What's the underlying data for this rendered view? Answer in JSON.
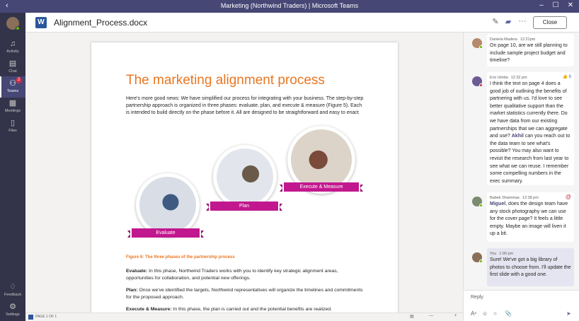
{
  "titlebar": {
    "back": "‹",
    "title": "Marketing (Northwind Traders)  |  Microsoft Teams",
    "minimize": "–",
    "maximize": "☐",
    "close": "✕"
  },
  "rail": {
    "items": [
      {
        "label": "Activity",
        "icon": "bell-icon",
        "glyph": "🔔"
      },
      {
        "label": "Chat",
        "icon": "chat-icon",
        "glyph": "▤"
      },
      {
        "label": "Teams",
        "icon": "teams-icon",
        "glyph": "⚇",
        "badge": "2"
      },
      {
        "label": "Meetings",
        "icon": "calendar-icon",
        "glyph": "▦"
      },
      {
        "label": "Files",
        "icon": "file-icon",
        "glyph": "▯"
      }
    ],
    "bottom": [
      {
        "label": "Feedback",
        "icon": "lightbulb-icon",
        "glyph": "♢"
      },
      {
        "label": "Settings",
        "icon": "gear-icon",
        "glyph": "⚙"
      }
    ]
  },
  "header": {
    "filename": "Alignment_Process.docx",
    "word_letter": "W",
    "close_label": "Close",
    "edit_glyph": "✎",
    "chat_glyph": "▰",
    "more_glyph": "···"
  },
  "document": {
    "heading": "The marketing alignment process",
    "intro": "Here's more good news: We have simplified our process for integrating with your business. The step-by-step partnership approach is organized in three phases: evaluate, plan, and execute & measure (Figure 5). Each is intended to build directly on the phase before it. All are designed to be straightforward and easy to enact",
    "phases": [
      "Evaluate",
      "Plan",
      "Execute & Measure"
    ],
    "caption": "Figure 6: The three phases of the partnership process",
    "paragraphs": [
      {
        "term": "Evaluate:",
        "text": " In this phase, Northwind Traders works with you to identify key strategic alignment areas, opportunities for collaboration, and potential new offerings."
      },
      {
        "term": "Plan:",
        "text": " Once we've identified the targets, Northwind representatives will organize the timelines and commitments for the proposed approach."
      },
      {
        "term": "Execute & Measure:",
        "text": " In this phase, the plan is carried out and the potential benefits are realized."
      }
    ]
  },
  "statusbar": {
    "page": "PAGE 1 OF 1",
    "minus": "—",
    "plus": "+"
  },
  "chat": {
    "messages": [
      {
        "author": "Daniela Madera",
        "time": "12:21pm",
        "text": "On page 10, are we still planning to include sample project budget and timeline?",
        "avatar_color": "#b5896b"
      },
      {
        "author": "Eric Ishida",
        "time": "12:32 pm",
        "likes": "6",
        "text_before": "I think the text on page 4 does a good job of outlining the benefits of partnering with us.  I'd love to see better qualitative support than the market statistics currently there. Do we have data from our existing partnerships that we can aggregate and use? ",
        "mention": "Akhil",
        "text_after": " can you reach out to the data team to see what's possible?  You may also want to revisit the research from last year to see what we can reuse. I remember some compelling numbers in the exec summary.",
        "avatar_color": "#6b5b95"
      },
      {
        "author": "Babek Shammas",
        "time": "12:38 pm",
        "mention": "Miguel",
        "text_after": ", does the design team have any stock photography we can use for the cover page?  It feels a little empty. Maybe an image will liven it up a bit.",
        "avatar_color": "#7a8b6f"
      },
      {
        "author": "You",
        "time": "1:00 pm",
        "text": "Sure! We've got a big library of photos to choose from. I'll update the first slide with a good one.",
        "avatar_color": "#8a6f5a"
      }
    ],
    "reply_placeholder": "Reply",
    "tools": [
      "format-icon",
      "emoji-icon",
      "gif-icon",
      "attach-icon",
      "send-icon"
    ]
  },
  "colors": {
    "titlebar": "#464775",
    "rail": "#33344a",
    "accent_orange": "#e87722",
    "ribbon_magenta": "#c2188f",
    "teams_purple": "#6264a7"
  }
}
